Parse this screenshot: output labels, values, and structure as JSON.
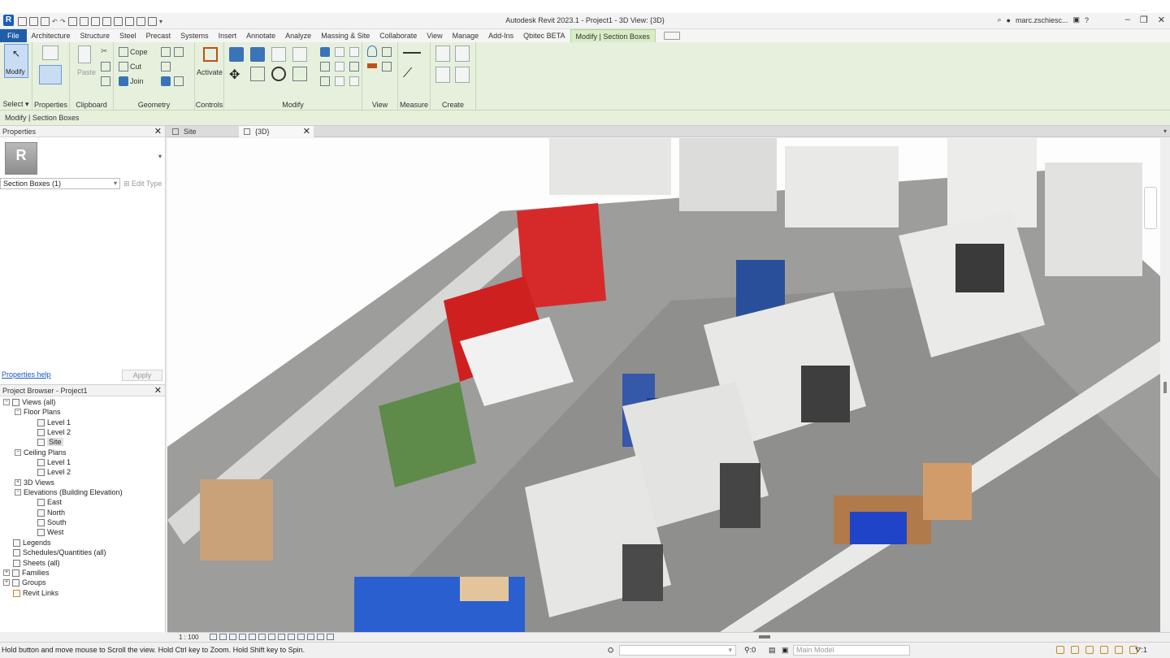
{
  "app": {
    "logo": "R",
    "title": "Autodesk Revit 2023.1 - Project1 - 3D View: {3D}",
    "user": "marc.zschiesc...",
    "help": "?"
  },
  "ribbon_tabs": [
    "File",
    "Architecture",
    "Structure",
    "Steel",
    "Precast",
    "Systems",
    "Insert",
    "Annotate",
    "Analyze",
    "Massing & Site",
    "Collaborate",
    "View",
    "Manage",
    "Add-Ins",
    "Qbitec BETA",
    "Modify | Section Boxes"
  ],
  "ribbon": {
    "select": {
      "modify_label": "Modify",
      "panel": "Select"
    },
    "properties": {
      "panel": "Properties"
    },
    "clipboard": {
      "paste_label": "Paste",
      "panel": "Clipboard"
    },
    "geometry": {
      "cope": "Cope",
      "cut": "Cut",
      "join": "Join",
      "panel": "Geometry"
    },
    "controls": {
      "activate": "Activate",
      "panel": "Controls"
    },
    "modify": {
      "panel": "Modify"
    },
    "view": {
      "panel": "View"
    },
    "measure": {
      "panel": "Measure"
    },
    "create": {
      "panel": "Create"
    }
  },
  "options_bar": {
    "label": "Modify | Section Boxes"
  },
  "properties": {
    "title": "Properties",
    "type_icon": "R",
    "selector": "Section Boxes (1)",
    "edit_type": "Edit Type",
    "help_link": "Properties help",
    "apply": "Apply"
  },
  "browser": {
    "title": "Project Browser - Project1",
    "nodes": [
      {
        "label": "Views (all)"
      },
      {
        "label": "Floor Plans"
      },
      {
        "label": "Level 1"
      },
      {
        "label": "Level 2"
      },
      {
        "label": "Site"
      },
      {
        "label": "Ceiling Plans"
      },
      {
        "label": "Level 1"
      },
      {
        "label": "Level 2"
      },
      {
        "label": "3D Views"
      },
      {
        "label": "Elevations (Building Elevation)"
      },
      {
        "label": "East"
      },
      {
        "label": "North"
      },
      {
        "label": "South"
      },
      {
        "label": "West"
      },
      {
        "label": "Legends"
      },
      {
        "label": "Schedules/Quantities (all)"
      },
      {
        "label": "Sheets (all)"
      },
      {
        "label": "Families"
      },
      {
        "label": "Groups"
      },
      {
        "label": "Revit Links"
      }
    ]
  },
  "view_tabs": [
    {
      "label": "Site"
    },
    {
      "label": "{3D}"
    }
  ],
  "view_control": {
    "scale": "1 : 100"
  },
  "status": {
    "message": "Hold button and move mouse to Scroll the view. Hold Ctrl key to Zoom. Hold Shift key to Spin.",
    "filter_count": ":0",
    "model": "Main Model",
    "selection_count": ":1"
  },
  "colors": {
    "file_tab": "#1f5ea8",
    "contextual_ribbon": "#e6f0dc",
    "link": "#1a56c4"
  }
}
